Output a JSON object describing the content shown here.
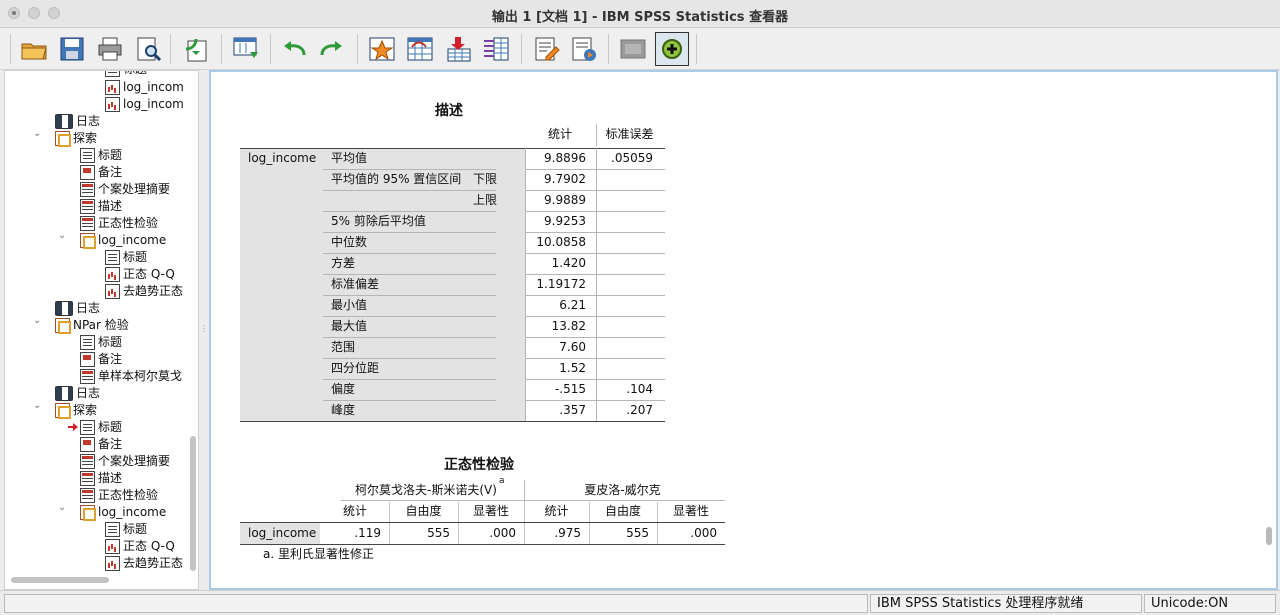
{
  "window": {
    "title": "输出 1 [文档 1] - IBM SPSS Statistics 查看器"
  },
  "toolbar": {
    "icons": [
      "open-folder-icon",
      "save-icon",
      "print-icon",
      "print-preview-icon",
      "export-icon",
      "goto-data-icon",
      "undo-icon",
      "redo-icon",
      "goto-case-icon",
      "goto-variable-icon",
      "insert-cases-icon",
      "variables-icon",
      "create-title-icon",
      "create-text-icon",
      "hide-icon",
      "promote-icon"
    ]
  },
  "nav": {
    "items": [
      {
        "label": "标题",
        "icon": "doc-icon"
      },
      {
        "label": "log_incom",
        "icon": "chart-icon"
      },
      {
        "label": "log_incom",
        "icon": "chart-icon"
      },
      {
        "label": "日志",
        "icon": "log-icon"
      },
      {
        "label": "探索",
        "icon": "proc-icon"
      },
      {
        "label": "标题",
        "icon": "doc-icon"
      },
      {
        "label": "备注",
        "icon": "notes-icon"
      },
      {
        "label": "个案处理摘要",
        "icon": "table-icon"
      },
      {
        "label": "描述",
        "icon": "table-icon"
      },
      {
        "label": "正态性检验",
        "icon": "table-icon"
      },
      {
        "label": "log_income",
        "icon": "proc-icon"
      },
      {
        "label": "标题",
        "icon": "doc-icon"
      },
      {
        "label": "正态 Q-Q",
        "icon": "chart-icon"
      },
      {
        "label": "去趋势正态",
        "icon": "chart-icon"
      },
      {
        "label": "日志",
        "icon": "log-icon"
      },
      {
        "label": "NPar 检验",
        "icon": "proc-icon"
      },
      {
        "label": "标题",
        "icon": "doc-icon"
      },
      {
        "label": "备注",
        "icon": "notes-icon"
      },
      {
        "label": "单样本柯尔莫戈",
        "icon": "table-icon"
      },
      {
        "label": "日志",
        "icon": "log-icon"
      },
      {
        "label": "探索",
        "icon": "proc-icon"
      },
      {
        "label": "标题",
        "icon": "doc-icon"
      },
      {
        "label": "备注",
        "icon": "notes-icon"
      },
      {
        "label": "个案处理摘要",
        "icon": "table-icon"
      },
      {
        "label": "描述",
        "icon": "table-icon"
      },
      {
        "label": "正态性检验",
        "icon": "table-icon"
      },
      {
        "label": "log_income",
        "icon": "proc-icon"
      },
      {
        "label": "标题",
        "icon": "doc-icon"
      },
      {
        "label": "正态 Q-Q",
        "icon": "chart-icon"
      },
      {
        "label": "去趋势正态",
        "icon": "chart-icon"
      }
    ]
  },
  "descriptives": {
    "title": "描述",
    "col_stat": "统计",
    "col_se": "标准误差",
    "variable": "log_income",
    "ci_label": "平均值的 95% 置信区间",
    "rows": [
      {
        "label": "平均值",
        "sub": "",
        "stat": "9.8896",
        "se": ".05059"
      },
      {
        "label": "",
        "sub": "下限",
        "stat": "9.7902",
        "se": ""
      },
      {
        "label": "",
        "sub": "上限",
        "stat": "9.9889",
        "se": ""
      },
      {
        "label": "5% 剪除后平均值",
        "sub": "",
        "stat": "9.9253",
        "se": ""
      },
      {
        "label": "中位数",
        "sub": "",
        "stat": "10.0858",
        "se": ""
      },
      {
        "label": "方差",
        "sub": "",
        "stat": "1.420",
        "se": ""
      },
      {
        "label": "标准偏差",
        "sub": "",
        "stat": "1.19172",
        "se": ""
      },
      {
        "label": "最小值",
        "sub": "",
        "stat": "6.21",
        "se": ""
      },
      {
        "label": "最大值",
        "sub": "",
        "stat": "13.82",
        "se": ""
      },
      {
        "label": "范围",
        "sub": "",
        "stat": "7.60",
        "se": ""
      },
      {
        "label": "四分位距",
        "sub": "",
        "stat": "1.52",
        "se": ""
      },
      {
        "label": "偏度",
        "sub": "",
        "stat": "-.515",
        "se": ".104"
      },
      {
        "label": "峰度",
        "sub": "",
        "stat": ".357",
        "se": ".207"
      }
    ]
  },
  "normality": {
    "title": "正态性检验",
    "ks_header": "柯尔莫戈洛夫-斯米诺夫(V)",
    "ks_sup": "a",
    "sw_header": "夏皮洛-威尔克",
    "cols": [
      "统计",
      "自由度",
      "显著性",
      "统计",
      "自由度",
      "显著性"
    ],
    "variable": "log_income",
    "values": [
      ".119",
      "555",
      ".000",
      ".975",
      "555",
      ".000"
    ],
    "footnote": "a. 里利氏显著性修正"
  },
  "status": {
    "message": "IBM SPSS Statistics 处理程序就绪",
    "unicode": "Unicode:ON"
  }
}
